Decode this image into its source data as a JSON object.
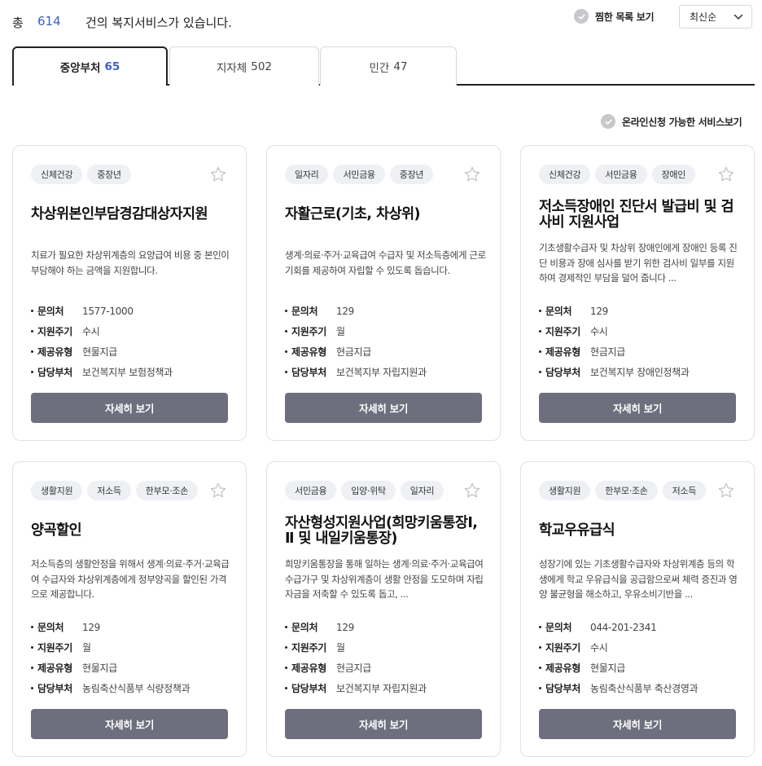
{
  "summary": {
    "prefix": "총",
    "count": "614",
    "suffix": "건의 복지서비스가 있습니다."
  },
  "saved_toggle": {
    "label": "찜한 목록 보기",
    "icon": "check-circle-icon"
  },
  "sort": {
    "selected": "최신순",
    "icon": "chevron-down-icon"
  },
  "tabs": [
    {
      "label": "중앙부처",
      "count": "65",
      "active": true
    },
    {
      "label": "지자체",
      "count": "502",
      "active": false
    },
    {
      "label": "민간",
      "count": "47",
      "active": false
    }
  ],
  "online_toggle": {
    "label": "온라인신청 가능한 서비스보기",
    "icon": "check-circle-icon"
  },
  "detail_label": "자세히 보기",
  "info_keys": {
    "contact": "문의처",
    "cycle": "지원주기",
    "type": "제공유형",
    "dept": "담당부처"
  },
  "colors": {
    "accent": "#3d5fc8",
    "button": "#6e6f7e",
    "tag_bg": "#eef0f4"
  },
  "cards": [
    {
      "tags": [
        "신체건강",
        "중장년"
      ],
      "title": "차상위본인부담경감대상자지원",
      "desc": "치료가 필요한 차상위계층의 요양급여 비용 중  본인이 부담해야 하는 금액을 지원합니다.",
      "contact": "1577-1000",
      "cycle": "수시",
      "type": "현물지급",
      "dept": "보건복지부 보험정책과"
    },
    {
      "tags": [
        "일자리",
        "서민금융",
        "중장년"
      ],
      "title": "자활근로(기초, 차상위)",
      "desc": "생계·의료·주거·교육급여 수급자 및 저소득층에게 근로기회를 제공하여  자립할 수 있도록 돕습니다.",
      "contact": "129",
      "cycle": "월",
      "type": "현금지급",
      "dept": "보건복지부 자립지원과"
    },
    {
      "tags": [
        "신체건강",
        "서민금융",
        "장애인"
      ],
      "title": "저소득장애인 진단서 발급비 및 검사비 지원사업",
      "desc": "기초생활수급자 및 차상위 장애인에게 장애인 등록 진단 비용과 장애 심사를 받기 위한 검사비 일부를 지원하여 경제적인 부담을 덜어 줍니다 ...",
      "contact": "129",
      "cycle": "수시",
      "type": "현금지급",
      "dept": "보건복지부 장애인정책과"
    },
    {
      "tags": [
        "생활지원",
        "저소득",
        "한부모·조손"
      ],
      "title": "양곡할인",
      "desc": "저소득층의 생활안정을 위해서 생계·의료·주거·교육급여 수급자와 차상위계층에게   정부양곡을 할인된 가격으로 제공합니다.",
      "contact": "129",
      "cycle": "월",
      "type": "현물지급",
      "dept": "농림축산식품부 식량정책과"
    },
    {
      "tags": [
        "서민금융",
        "입양·위탁",
        "일자리"
      ],
      "title": "자산형성지원사업(희망키움통장Ⅰ, Ⅱ 및 내일키움통장)",
      "desc": "희망키움통장을 통해 일하는 생계·의료·주거·교육급여 수급가구 및 차상위계층이  생활 안정을 도모하며 자립자금을 저축할 수 있도록 돕고, ...",
      "contact": "129",
      "cycle": "월",
      "type": "현금지급",
      "dept": "보건복지부 자립지원과"
    },
    {
      "tags": [
        "생활지원",
        "한부모·조손",
        "저소득"
      ],
      "title": "학교우유급식",
      "desc": "성장기에 있는 기초생활수급자와 차상위계층 등의 학생에게 학교 우유급식을 공급함으로써 체력 증진과 영양 불균형을 해소하고, 우유소비기반을 ...",
      "contact": "044-201-2341",
      "cycle": "수시",
      "type": "현물지급",
      "dept": "농림축산식품부 축산경영과"
    }
  ]
}
